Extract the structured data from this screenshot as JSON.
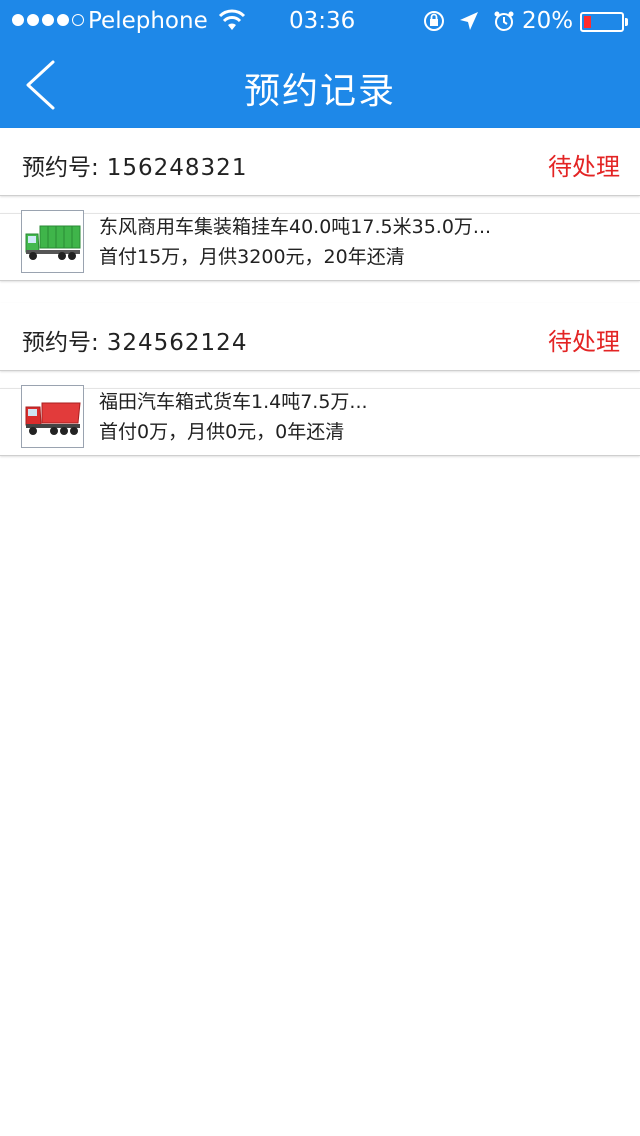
{
  "status_bar": {
    "carrier": "Pelephone",
    "time": "03:36",
    "battery": "20%",
    "battery_level": 0.2,
    "signal_filled": 4,
    "signal_total": 5
  },
  "nav": {
    "title": "预约记录",
    "back_icon": "chevron-left-icon"
  },
  "records": [
    {
      "order_label": "预约号:",
      "order_number": "156248321",
      "status": "待处理",
      "vehicle_title": "东风商用车集装箱挂车40.0吨17.5米35.0万...",
      "vehicle_terms": "首付15万，月供3200元，20年还清",
      "thumb_icon": "green-truck-icon"
    },
    {
      "order_label": "预约号:",
      "order_number": "324562124",
      "status": "待处理",
      "vehicle_title": "福田汽车箱式货车1.4吨7.5万...",
      "vehicle_terms": "首付0万，月供0元，0年还清",
      "thumb_icon": "red-truck-icon"
    }
  ],
  "colors": {
    "primary": "#1e88e8",
    "status_pending": "#e32424"
  }
}
